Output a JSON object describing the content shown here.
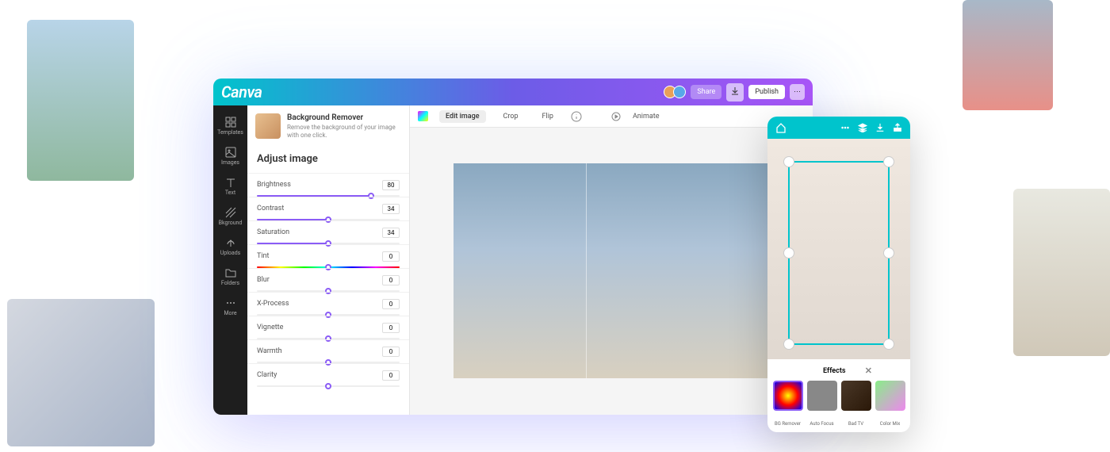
{
  "logo": "Canva",
  "topbar": {
    "share": "Share",
    "publish": "Publish"
  },
  "sidebar": {
    "items": [
      {
        "label": "Templates"
      },
      {
        "label": "Images"
      },
      {
        "label": "Text"
      },
      {
        "label": "Bkground"
      },
      {
        "label": "Uploads"
      },
      {
        "label": "Folders"
      },
      {
        "label": "More"
      }
    ]
  },
  "feature": {
    "title": "Background Remover",
    "desc": "Remove the background of your image with one click."
  },
  "panel_title": "Adjust image",
  "adjustments": [
    {
      "label": "Brightness",
      "value": "80",
      "pct": 80
    },
    {
      "label": "Contrast",
      "value": "34",
      "pct": 50
    },
    {
      "label": "Saturation",
      "value": "34",
      "pct": 50
    },
    {
      "label": "Tint",
      "value": "0",
      "pct": 50,
      "rainbow": true
    },
    {
      "label": "Blur",
      "value": "0",
      "pct": 50
    },
    {
      "label": "X-Process",
      "value": "0",
      "pct": 50
    },
    {
      "label": "Vignette",
      "value": "0",
      "pct": 50
    },
    {
      "label": "Warmth",
      "value": "0",
      "pct": 50
    },
    {
      "label": "Clarity",
      "value": "0",
      "pct": 50
    }
  ],
  "toolbar": {
    "edit": "Edit image",
    "crop": "Crop",
    "flip": "Flip",
    "animate": "Animate"
  },
  "mobile": {
    "effects_title": "Effects",
    "items": [
      {
        "label": "BG Remover"
      },
      {
        "label": "Auto Focus"
      },
      {
        "label": "Bad TV"
      },
      {
        "label": "Color Mix"
      }
    ]
  }
}
